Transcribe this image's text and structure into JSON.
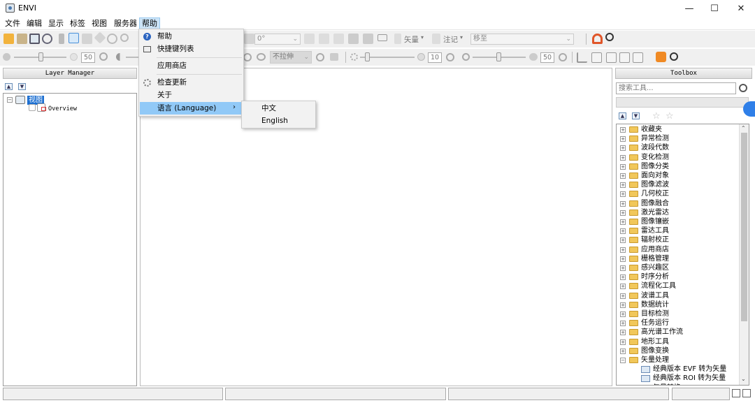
{
  "app": {
    "title": "ENVI",
    "minimize": "—",
    "maximize": "☐",
    "close": "✕"
  },
  "menubar": [
    "文件",
    "编辑",
    "显示",
    "标签",
    "视图",
    "服务器",
    "帮助"
  ],
  "toolbar1": {
    "rotation_value": "0°",
    "vector_label": "矢量",
    "annotation_label": "注记",
    "goto_placeholder": "移至"
  },
  "toolbar2": {
    "brightness": "50",
    "stretch_value": "不拉伸",
    "sharpen": "10",
    "transparency": "50"
  },
  "layer_manager": {
    "title": "Layer Manager",
    "root": "视图",
    "child": "Overview"
  },
  "help_menu": {
    "items": [
      "帮助",
      "快捷键列表",
      "应用商店",
      "检查更新",
      "关于",
      "语言 (Language)"
    ]
  },
  "language_submenu": [
    "中文",
    "English"
  ],
  "toolbox": {
    "title": "Toolbox",
    "search_placeholder": "搜索工具...",
    "folders": [
      "收藏夹",
      "异常检测",
      "波段代数",
      "变化检测",
      "图像分类",
      "面向对象",
      "图像滤波",
      "几何校正",
      "图像融合",
      "激光雷达",
      "图像镶嵌",
      "雷达工具",
      "辐射校正",
      "应用商店",
      "栅格管理",
      "感兴趣区",
      "时序分析",
      "流程化工具",
      "波谱工具",
      "数据统计",
      "目标检测",
      "任务运行",
      "高光谱工作流",
      "地形工具",
      "图像变换",
      "矢量处理"
    ],
    "subitems": [
      "经典版本 EVF 转为矢量",
      "经典版本 ROI 转为矢量",
      "矢量转换"
    ]
  },
  "colors": {
    "accent": "#91c9f7",
    "folder": "#f1c75a",
    "panel_bg": "#f0f0f0"
  }
}
